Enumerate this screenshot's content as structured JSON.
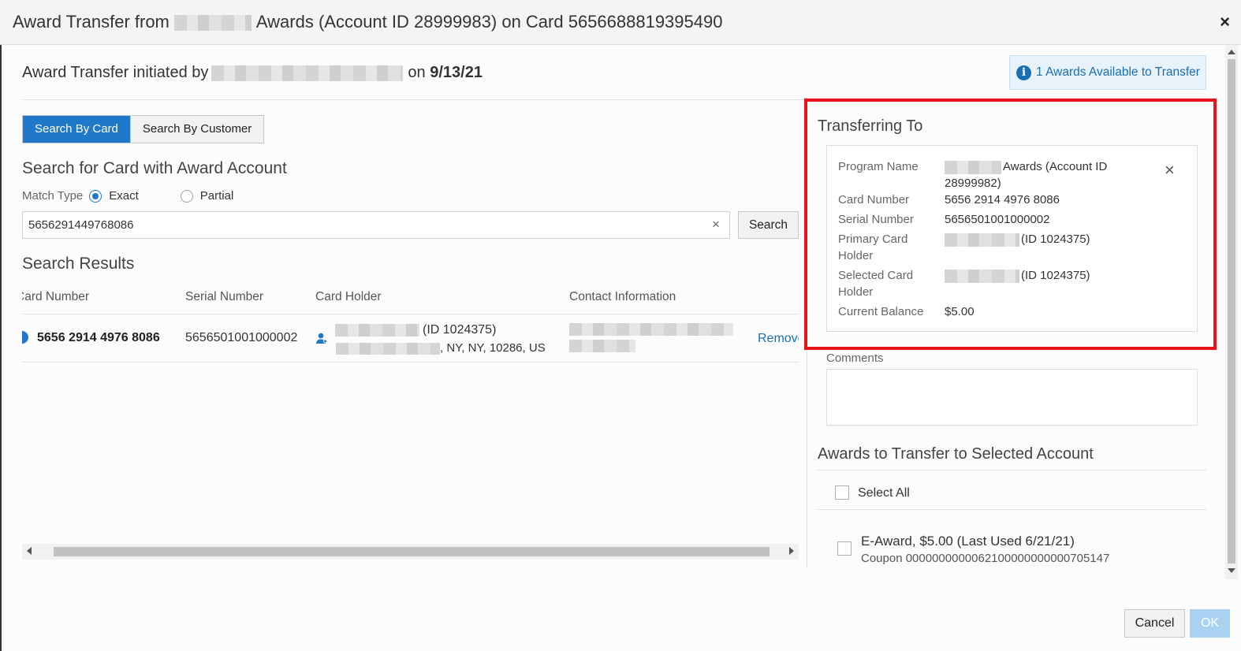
{
  "titlebar": {
    "prefix": "Award Transfer from",
    "suffix": "Awards (Account ID 28999983) on Card 5656688819395490",
    "close": "×"
  },
  "initiated": {
    "prefix": "Award Transfer initiated by",
    "on": "on",
    "date": "9/13/21"
  },
  "badge": {
    "icon": "info-icon",
    "icon_glyph": "i",
    "text": "1 Awards Available to Transfer",
    "color": "#1a6fb3"
  },
  "tabs": {
    "by_card": "Search By Card",
    "by_customer": "Search By Customer",
    "active_color": "#1f78c8"
  },
  "search": {
    "heading": "Search for Card with Award Account",
    "match_type_label": "Match Type",
    "exact": "Exact",
    "partial": "Partial",
    "selected": "Exact",
    "value": "5656291449768086",
    "clear": "×",
    "button": "Search"
  },
  "results": {
    "heading": "Search Results",
    "columns": [
      "Card Number",
      "Serial Number",
      "Card Holder",
      "Contact Information"
    ],
    "row": {
      "card_number": "5656 2914 4976 8086",
      "serial_number": "5656501001000002",
      "holder_id": "(ID 1024375)",
      "holder_address": ", NY, NY, 10286, US",
      "action": "Remove"
    }
  },
  "transfer_to": {
    "heading": "Transferring To",
    "close": "×",
    "fields": {
      "program_name_label": "Program Name",
      "program_name_value": "Awards (Account ID",
      "program_name_value2": "28999982)",
      "card_number_label": "Card Number",
      "card_number_value": "5656 2914 4976 8086",
      "serial_number_label": "Serial Number",
      "serial_number_value": "5656501001000002",
      "primary_holder_label1": "Primary Card",
      "primary_holder_label2": "Holder",
      "primary_holder_value": "(ID 1024375)",
      "selected_holder_label1": "Selected Card",
      "selected_holder_label2": "Holder",
      "selected_holder_value": "(ID 1024375)",
      "balance_label": "Current Balance",
      "balance_value": "$5.00"
    },
    "highlight_color": "#e8141c"
  },
  "comments": {
    "label": "Comments",
    "value": ""
  },
  "awards": {
    "heading": "Awards to Transfer to Selected Account",
    "select_all": "Select All",
    "items": [
      {
        "title": "E-Award, $5.00 (Last Used 6/21/21)",
        "coupon": "Coupon 0000000000062100000000000705147"
      }
    ]
  },
  "footer": {
    "cancel": "Cancel",
    "ok": "OK"
  }
}
